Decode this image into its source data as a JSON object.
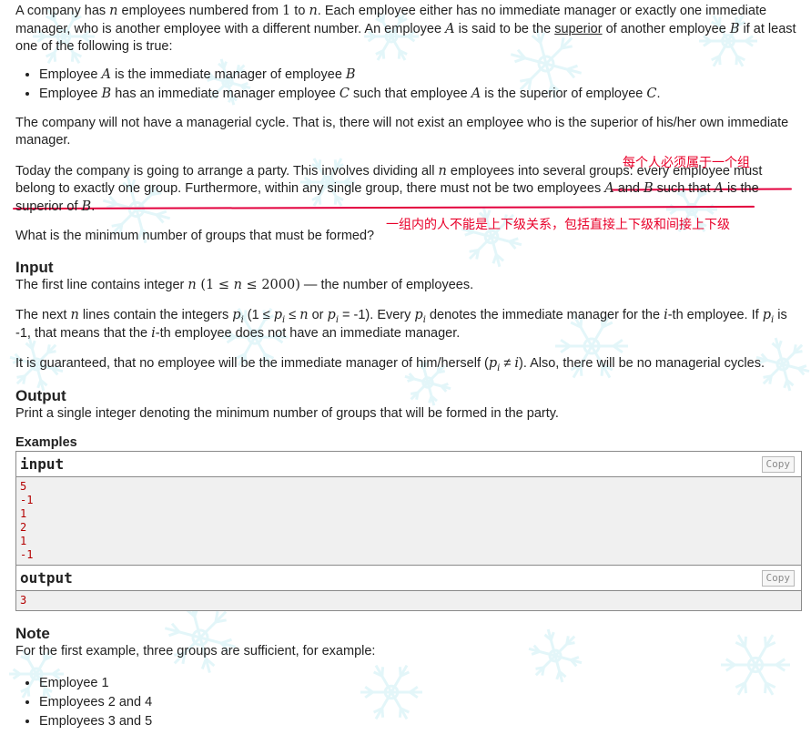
{
  "statement": {
    "p1_a": "A company has ",
    "p1_n": "n",
    "p1_b": " employees numbered from ",
    "p1_one": "1",
    "p1_c": " to ",
    "p1_n2": "n",
    "p1_d": ". Each employee either has no immediate manager or exactly one immediate manager, who is another employee with a different number. An employee ",
    "p1_A": "A",
    "p1_e": " is said to be the ",
    "p1_superior": "superior",
    "p1_f": " of another employee ",
    "p1_B": "B",
    "p1_g": " if at least one of the following is true:",
    "li1_a": "Employee ",
    "li1_A": "A",
    "li1_b": " is the immediate manager of employee ",
    "li1_B": "B",
    "li2_a": "Employee ",
    "li2_B": "B",
    "li2_b": " has an immediate manager employee ",
    "li2_C": "C",
    "li2_c": " such that employee ",
    "li2_A": "A",
    "li2_d": " is the superior of employee ",
    "li2_C2": "C",
    "li2_e": ".",
    "p2": "The company will not have a managerial cycle. That is, there will not exist an employee who is the superior of his/her own immediate manager.",
    "p3_a": "Today the company is going to arrange a party. This involves dividing all ",
    "p3_n": "n",
    "p3_b": " employees into several groups: every employee must belong to exactly one group. Furthermore, within any single group, there must not be two employees ",
    "p3_A": "A",
    "p3_c": " and ",
    "p3_B": "B",
    "p3_d": " such that ",
    "p3_A2": "A",
    "p3_e": " is the superior of ",
    "p3_B2": "B",
    "p3_f": ".",
    "p4": "What is the minimum number of groups that must be formed?"
  },
  "annotations": {
    "note1": "每个人必须属于一个组",
    "note2": "一组内的人不能是上下级关系，包括直接上下级和间接上下级",
    "color": "#e3003d"
  },
  "input_section": {
    "title": "Input",
    "l1_a": "The first line contains integer ",
    "l1_n": "n",
    "l1_paren": " (1 ≤ ",
    "l1_n2": "n",
    "l1_rng": " ≤ 2000)",
    "l1_b": " — the number of employees.",
    "l2_a": "The next ",
    "l2_n": "n",
    "l2_b": " lines contain the integers ",
    "l2_p": "p",
    "l2_i": "i",
    "l2_c": " (1 ≤ ",
    "l2_p2": "p",
    "l2_i2": "i",
    "l2_d": " ≤ ",
    "l2_n2": "n",
    "l2_e": " or ",
    "l2_p3": "p",
    "l2_i3": "i",
    "l2_f": " = -1). Every ",
    "l2_p4": "p",
    "l2_i4": "i",
    "l2_g": " denotes the immediate manager for the ",
    "l2_i5": "i",
    "l2_h": "-th employee. If ",
    "l2_p5": "p",
    "l2_i6": "i",
    "l2_j": " is -1, that means that the ",
    "l2_i7": "i",
    "l2_k": "-th employee does not have an immediate manager.",
    "l3_a": "It is guaranteed, that no employee will be the immediate manager of him/herself (",
    "l3_p": "p",
    "l3_i": "i",
    "l3_ne": " ≠ ",
    "l3_i2": "i",
    "l3_b": "). Also, there will be no managerial cycles."
  },
  "output_section": {
    "title": "Output",
    "text": "Print a single integer denoting the minimum number of groups that will be formed in the party."
  },
  "examples": {
    "label": "Examples",
    "input_title": "input",
    "output_title": "output",
    "copy_label": "Copy",
    "input_text": "5\n-1\n1\n2\n1\n-1",
    "output_text": "3"
  },
  "note_section": {
    "title": "Note",
    "text": "For the first example, three groups are sufficient, for example:",
    "items": [
      "Employee 1",
      "Employees 2 and 4",
      "Employees 3 and 5"
    ]
  },
  "colors": {
    "text": "#222222",
    "snowflake": "#cdeff5",
    "io_background": "#f0f0f0",
    "sample_text": "#b40000"
  }
}
